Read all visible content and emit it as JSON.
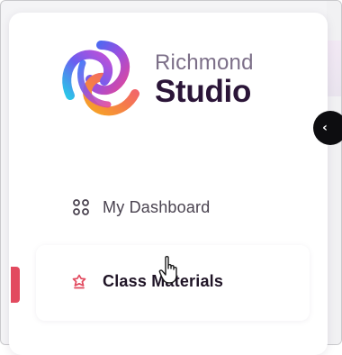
{
  "brand": {
    "name_top": "Richmond",
    "name_bottom": "Studio",
    "icon": "richmond-flower-logo"
  },
  "sidebar": {
    "collapse_icon": "chevron-left-icon",
    "collapse_glyph": "‹",
    "items": [
      {
        "label": "My Dashboard",
        "icon": "dashboard-grid-icon",
        "active": false
      },
      {
        "label": "Class Materials",
        "icon": "class-materials-icon",
        "active": true
      }
    ]
  },
  "colors": {
    "accent": "#e24a5f",
    "brand_dark": "#2b1538",
    "brand_muted": "#7c6f88"
  }
}
